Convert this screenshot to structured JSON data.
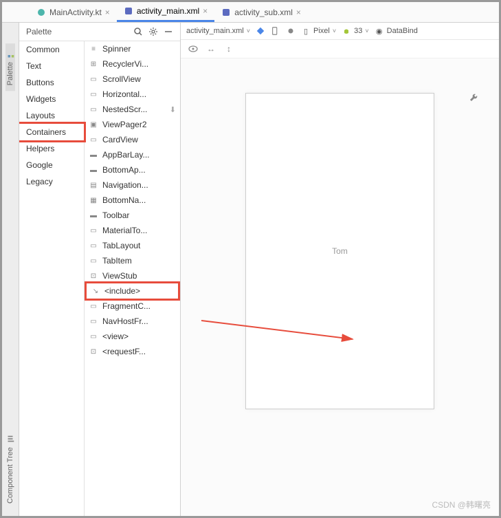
{
  "tabs": [
    {
      "label": "MainActivity.kt",
      "icon_color": "#4db6ac"
    },
    {
      "label": "activity_main.xml",
      "icon_color": "#5c6bc0",
      "active": true
    },
    {
      "label": "activity_sub.xml",
      "icon_color": "#5c6bc0"
    }
  ],
  "sidebar": {
    "top": "Palette",
    "bottom": "Component Tree"
  },
  "palette": {
    "title": "Palette",
    "categories": [
      {
        "name": "Common"
      },
      {
        "name": "Text"
      },
      {
        "name": "Buttons"
      },
      {
        "name": "Widgets"
      },
      {
        "name": "Layouts"
      },
      {
        "name": "Containers",
        "highlighted": true
      },
      {
        "name": "Helpers"
      },
      {
        "name": "Google"
      },
      {
        "name": "Legacy"
      }
    ],
    "components": [
      {
        "label": "Spinner",
        "icon": "≡"
      },
      {
        "label": "RecyclerVi...",
        "icon": "⊞"
      },
      {
        "label": "ScrollView",
        "icon": "▭"
      },
      {
        "label": "Horizontal...",
        "icon": "▭"
      },
      {
        "label": "NestedScr...",
        "icon": "▭",
        "download": true
      },
      {
        "label": "ViewPager2",
        "icon": "▣"
      },
      {
        "label": "CardView",
        "icon": "▭"
      },
      {
        "label": "AppBarLay...",
        "icon": "▬"
      },
      {
        "label": "BottomAp...",
        "icon": "▬"
      },
      {
        "label": "Navigation...",
        "icon": "▤"
      },
      {
        "label": "BottomNa...",
        "icon": "▦"
      },
      {
        "label": "Toolbar",
        "icon": "▬"
      },
      {
        "label": "MaterialTo...",
        "icon": "▭"
      },
      {
        "label": "TabLayout",
        "icon": "▭"
      },
      {
        "label": "TabItem",
        "icon": "▭"
      },
      {
        "label": "ViewStub",
        "icon": "⊡"
      },
      {
        "label": "<include>",
        "icon": "↘",
        "highlighted": true
      },
      {
        "label": "FragmentC...",
        "icon": "▭"
      },
      {
        "label": "NavHostFr...",
        "icon": "▭"
      },
      {
        "label": "<view>",
        "icon": "▭"
      },
      {
        "label": "<requestF...",
        "icon": "⊡"
      }
    ]
  },
  "design_toolbar": {
    "file": "activity_main.xml",
    "device": "Pixel",
    "api": "33",
    "databinding": "DataBind"
  },
  "canvas": {
    "text": "Tom"
  },
  "watermark": "CSDN @韩曙亮"
}
